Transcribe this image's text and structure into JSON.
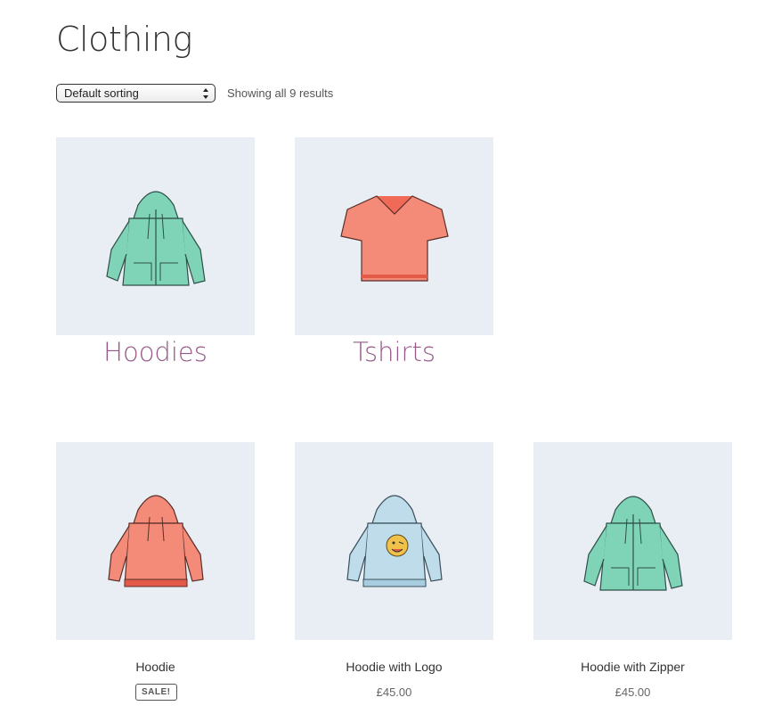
{
  "page": {
    "title": "Clothing"
  },
  "toolbar": {
    "sort_selected": "Default sorting",
    "result_count": "Showing all 9 results"
  },
  "categories": [
    {
      "label": "Hoodies"
    },
    {
      "label": "Tshirts"
    }
  ],
  "products": [
    {
      "title": "Hoodie",
      "badge": "SALE!"
    },
    {
      "title": "Hoodie with Logo",
      "price": "£45.00"
    },
    {
      "title": "Hoodie with Zipper",
      "price": "£45.00"
    }
  ],
  "colors": {
    "accent": "#96588a",
    "tile_bg": "#e8eef3",
    "mint": "#7fd4b8",
    "coral": "#f48a78",
    "light_blue": "#bfdcea"
  }
}
